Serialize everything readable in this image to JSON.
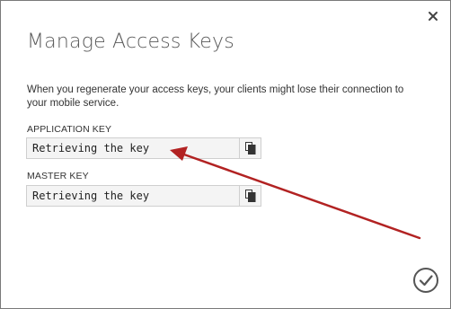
{
  "dialog": {
    "title": "Manage Access Keys",
    "description": "When you regenerate your access keys, your clients might lose their connection to your mobile service."
  },
  "application_key": {
    "label": "APPLICATION KEY",
    "value": "Retrieving the key"
  },
  "master_key": {
    "label": "MASTER KEY",
    "value": "Retrieving the key"
  },
  "icons": {
    "close": "close-icon",
    "copy": "copy-icon",
    "ok": "checkmark-circle-icon"
  },
  "colors": {
    "annotation_arrow": "#b22222",
    "field_background": "#f4f4f4",
    "title_text": "#5a5a5a"
  }
}
